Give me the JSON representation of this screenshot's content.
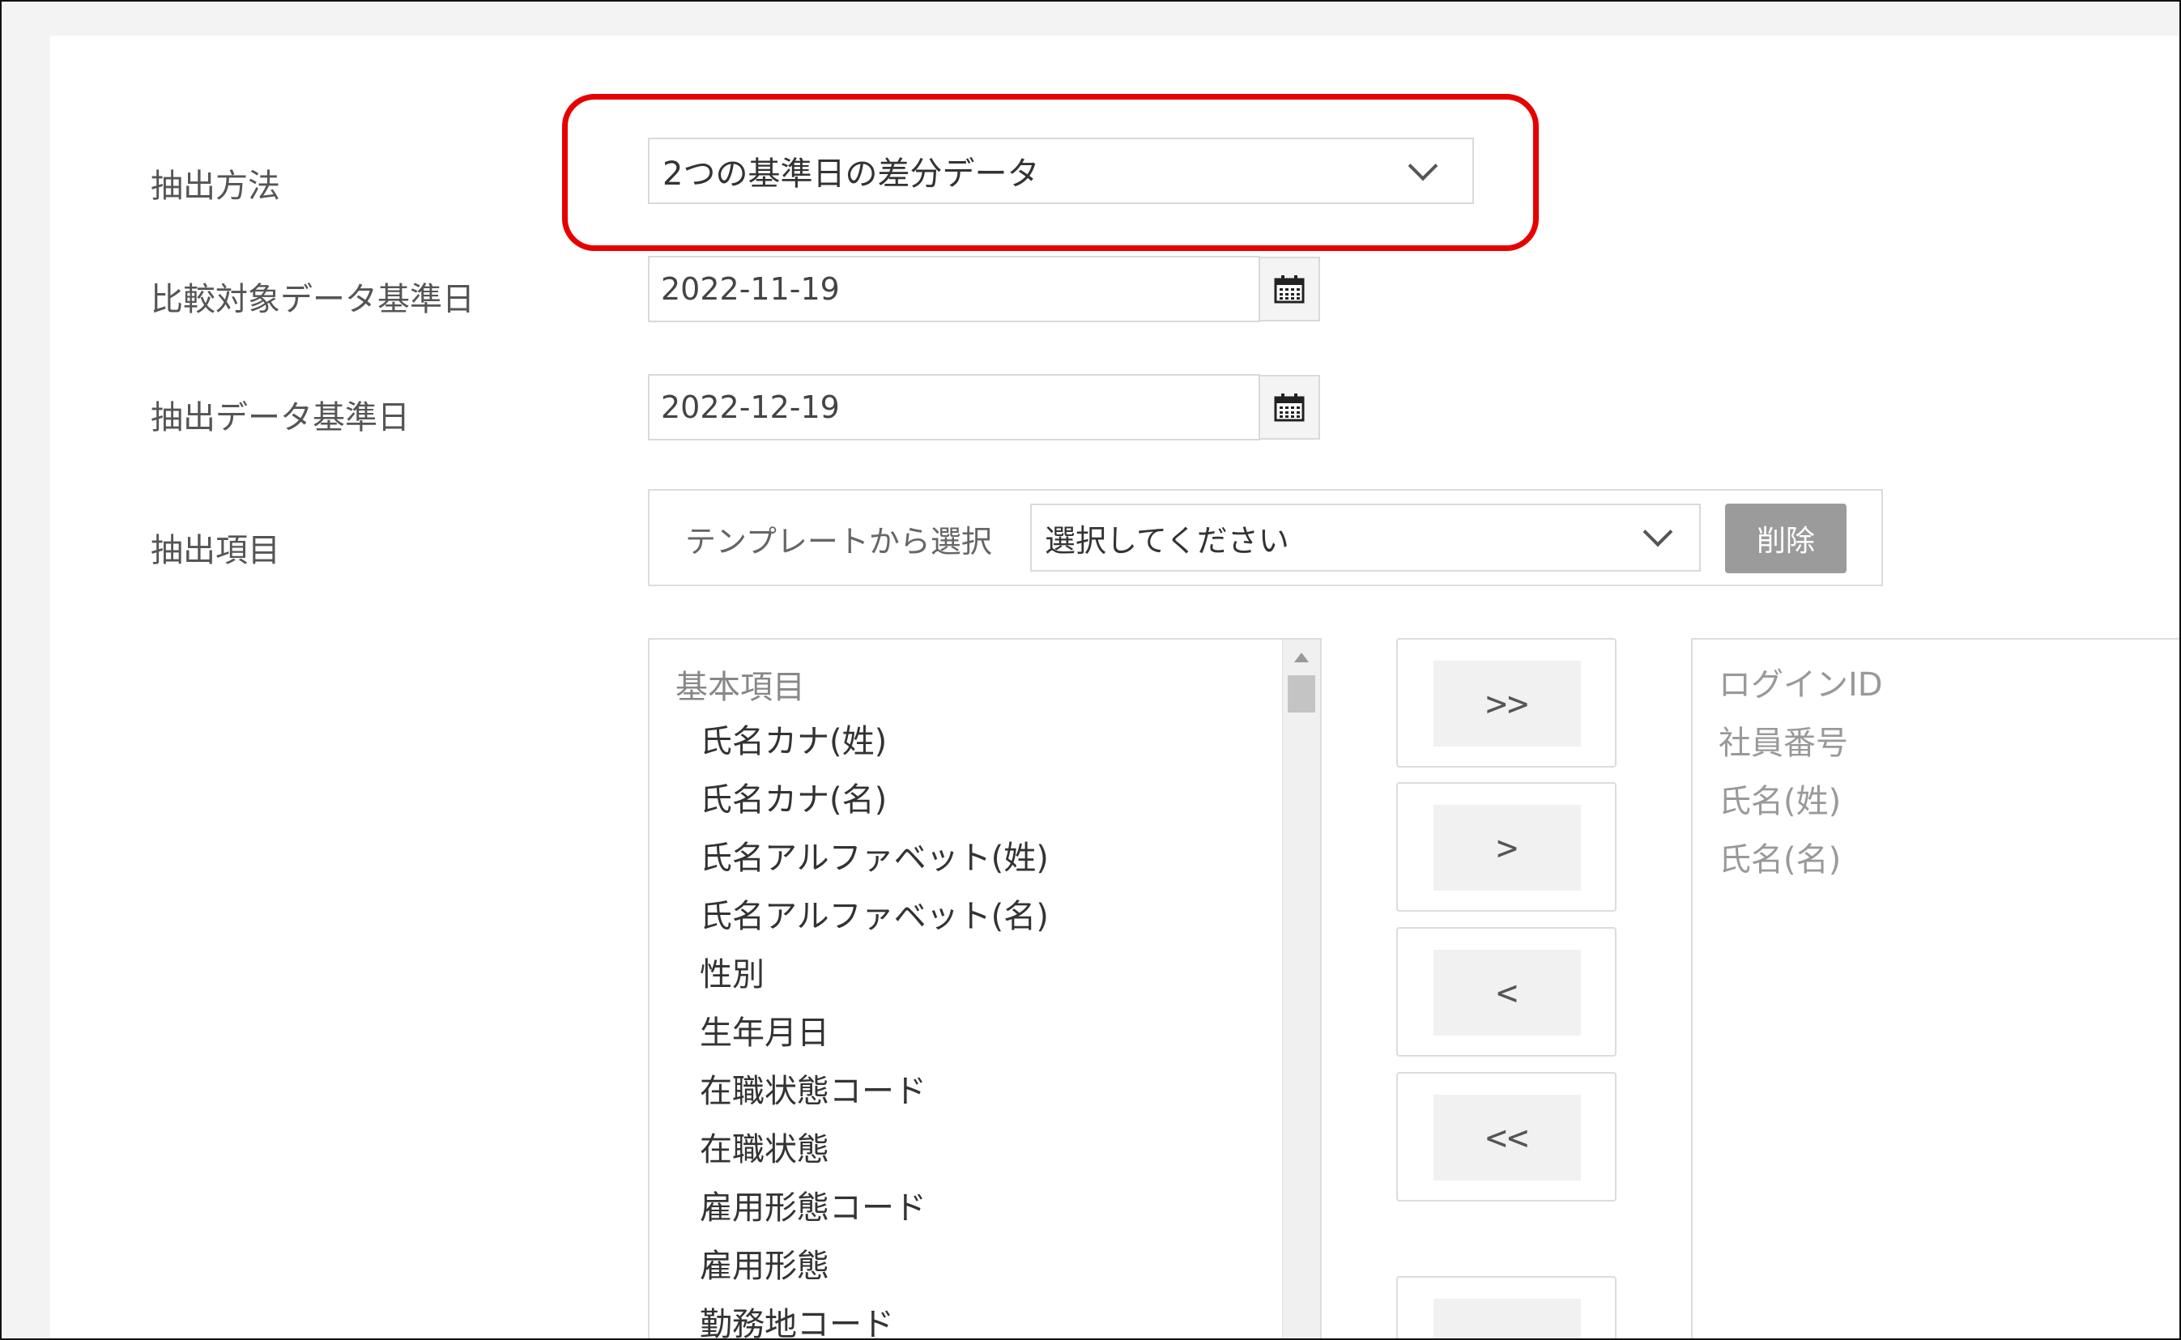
{
  "form": {
    "method_label": "抽出方法",
    "method_value": "2つの基準日の差分データ",
    "compare_date_label": "比較対象データ基準日",
    "compare_date_value": "2022-11-19",
    "extract_date_label": "抽出データ基準日",
    "extract_date_value": "2022-12-19",
    "items_label": "抽出項目"
  },
  "template": {
    "label": "テンプレートから選択",
    "select_value": "選択してください",
    "delete_label": "削除"
  },
  "available": {
    "group_label": "基本項目",
    "items": [
      "氏名カナ(姓)",
      "氏名カナ(名)",
      "氏名アルファベット(姓)",
      "氏名アルファベット(名)",
      "性別",
      "生年月日",
      "在職状態コード",
      "在職状態",
      "雇用形態コード",
      "雇用形態",
      "勤務地コード"
    ]
  },
  "move_buttons": {
    "add_all": ">>",
    "add": ">",
    "remove": "<",
    "remove_all": "<<"
  },
  "selected": {
    "items": [
      "ログインID",
      "社員番号",
      "氏名(姓)",
      "氏名(名)"
    ]
  },
  "colors": {
    "highlight": "#e60000",
    "delete_button": "#9b9b9b"
  }
}
